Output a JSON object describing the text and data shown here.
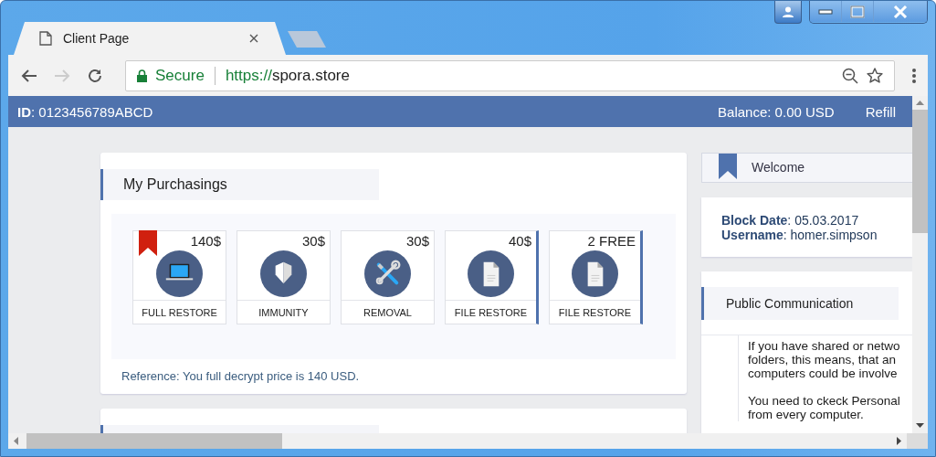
{
  "browser": {
    "tab_title": "Client Page",
    "security_label": "Secure",
    "url_scheme": "https://",
    "url_host": "spora.store"
  },
  "header": {
    "id_label": "ID",
    "id_value": ": 0123456789ABCD",
    "balance": "Balance: 0.00 USD",
    "refill": "Refill"
  },
  "purchasings": {
    "title": "My Purchasings",
    "items": [
      {
        "price": "140$",
        "label": "FULL RESTORE",
        "kind": "laptop",
        "bookmarked": true,
        "selected": false
      },
      {
        "price": "30$",
        "label": "IMMUNITY",
        "kind": "shield",
        "bookmarked": false,
        "selected": false
      },
      {
        "price": "30$",
        "label": "REMOVAL",
        "kind": "tools",
        "bookmarked": false,
        "selected": false
      },
      {
        "price": "40$",
        "label": "FILE RESTORE",
        "kind": "document",
        "bookmarked": false,
        "selected": true
      },
      {
        "price": "2 FREE",
        "label": "FILE RESTORE",
        "kind": "document",
        "bookmarked": false,
        "selected": true
      }
    ],
    "reference": "Reference: You full decrypt price is 140 USD."
  },
  "welcome": {
    "title": "Welcome"
  },
  "info": [
    {
      "label": "Block Date",
      "value": ": 05.03.2017"
    },
    {
      "label": "Username",
      "value": ": homer.simpson"
    }
  ],
  "communication": {
    "title": "Public Communication",
    "paragraphs": [
      [
        "If you have shared or netwo",
        "folders, this means, that an",
        "computers could be involve"
      ],
      [
        "You need to ckeck Personal",
        "from every computer."
      ]
    ]
  }
}
